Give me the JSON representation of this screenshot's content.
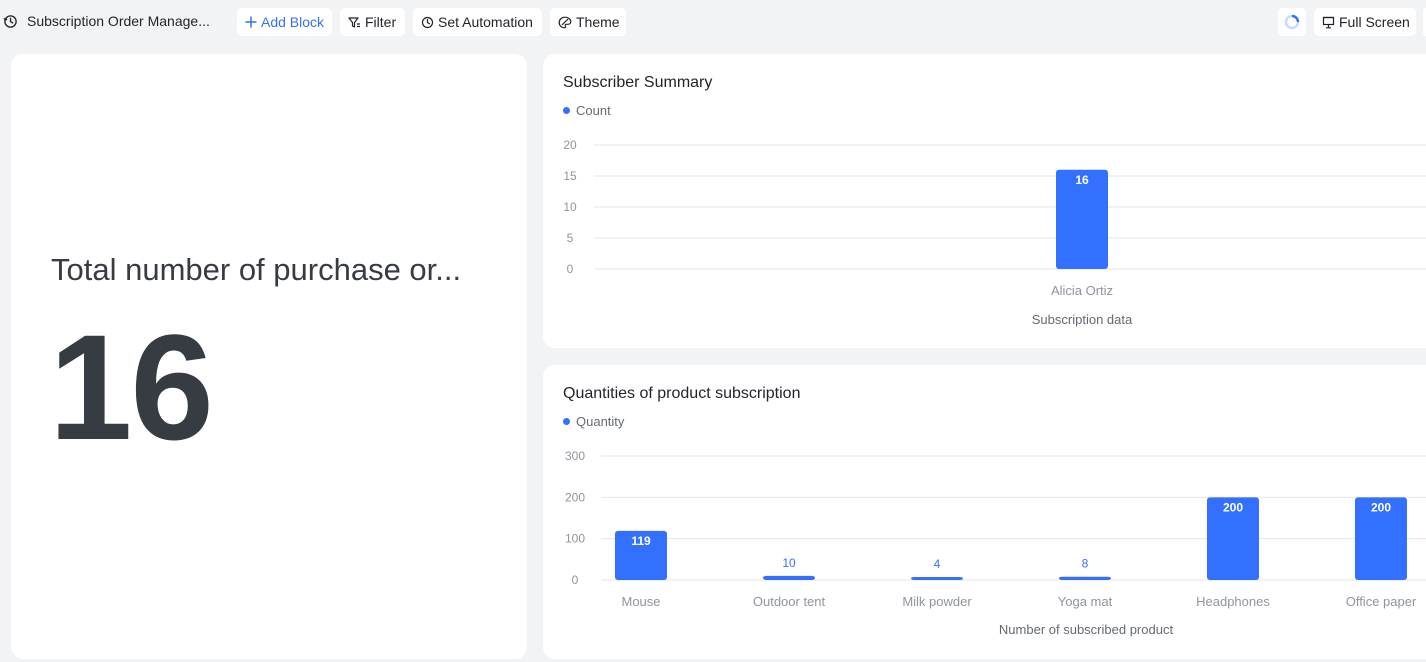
{
  "toolbar": {
    "title": "Subscription Order Manage...",
    "add_block": "Add Block",
    "filter": "Filter",
    "set_automation": "Set Automation",
    "theme": "Theme",
    "full_screen": "Full Screen"
  },
  "metric": {
    "title": "Total number of purchase or...",
    "value": "16"
  },
  "colors": {
    "accent": "#3370ff",
    "bar": "#3370ff",
    "grid": "#e5e6eb"
  },
  "chart_data": [
    {
      "type": "bar",
      "title": "Subscriber Summary",
      "legend": [
        "Count"
      ],
      "categories": [
        "Alicia Ortiz"
      ],
      "series": [
        {
          "name": "Count",
          "values": [
            16
          ]
        }
      ],
      "xlabel": "Subscription data",
      "ylabel": "",
      "ylim": [
        0,
        20
      ],
      "yticks": [
        0,
        5,
        10,
        15,
        20
      ],
      "grid": true,
      "legend_position": "top-left"
    },
    {
      "type": "bar",
      "title": "Quantities of product subscription",
      "legend": [
        "Quantity"
      ],
      "categories": [
        "Mouse",
        "Outdoor tent",
        "Milk powder",
        "Yoga mat",
        "Headphones",
        "Office paper"
      ],
      "series": [
        {
          "name": "Quantity",
          "values": [
            119,
            10,
            4,
            8,
            200,
            200
          ]
        }
      ],
      "xlabel": "Number of subscribed product",
      "ylabel": "",
      "ylim": [
        0,
        300
      ],
      "yticks": [
        0,
        100,
        200,
        300
      ],
      "grid": true,
      "legend_position": "top-left"
    }
  ]
}
